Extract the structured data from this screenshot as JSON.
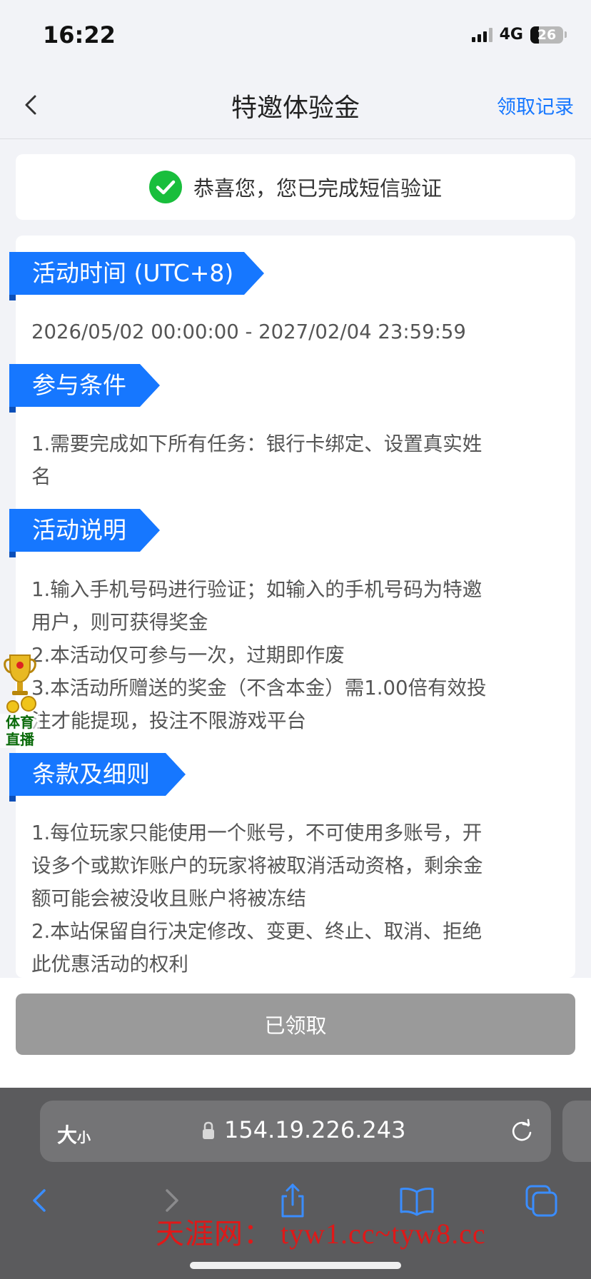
{
  "status_bar": {
    "time": "16:22",
    "network": "4G",
    "battery": "26",
    "battery_level": 0.26
  },
  "nav": {
    "title": "特邀体验金",
    "record_link": "领取记录"
  },
  "success": {
    "message": "恭喜您，您已完成短信验证"
  },
  "sections": [
    {
      "title": "活动时间 (UTC+8)",
      "lines": [
        "2026/05/02 00:00:00 - 2027/02/04 23:59:59"
      ]
    },
    {
      "title": "参与条件",
      "lines": [
        "1.需要完成如下所有任务：银行卡绑定、设置真实姓",
        "名"
      ]
    },
    {
      "title": "活动说明",
      "lines": [
        "1.输入手机号码进行验证；如输入的手机号码为特邀",
        "用户，则可获得奖金",
        "2.本活动仅可参与一次，过期即作废",
        "3.本活动所赠送的奖金（不含本金）需1.00倍有效投",
        "注才能提现，投注不限游戏平台"
      ]
    },
    {
      "title": "条款及细则",
      "lines": [
        "1.每位玩家只能使用一个账号，不可使用多账号，开",
        "设多个或欺诈账户的玩家将被取消活动资格，剩余金",
        "额可能会被没收且账户将被冻结",
        "2.本站保留自行决定修改、变更、终止、取消、拒绝",
        "此优惠活动的权利"
      ]
    }
  ],
  "bottom_button": {
    "label": "已领取"
  },
  "float_badge": {
    "line1": "体育",
    "line2": "直播"
  },
  "browser": {
    "size_label": "大",
    "size_label_small": "小",
    "url": "154.19.226.243",
    "watermark": "天涯网： tyw1.cc~tyw8.cc"
  },
  "colors": {
    "accent": "#1677ff",
    "success": "#19be3c",
    "disabled_button": "#9a9a9a",
    "watermark": "#e01818"
  }
}
